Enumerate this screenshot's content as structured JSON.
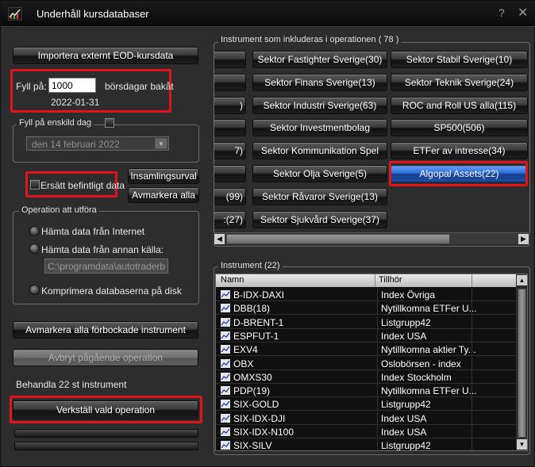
{
  "window": {
    "title": "Underhåll kursdatabaser",
    "help_glyph": "?",
    "close_glyph": "✕"
  },
  "left": {
    "import_button": "Importera externt EOD-kursdata",
    "fill_label": "Fyll på:",
    "fill_value": "1000",
    "fill_suffix": "börsdagar bakåt",
    "fill_date": "2022-01-31",
    "single_day_group": "Fyll på enskild dag",
    "single_day_value": "den 14   februari   2022",
    "replace_label": "Ersätt befintligt data",
    "collection_button": "Insamlingsurval",
    "unmark_all_button": "Avmarkera alla",
    "operation_group": "Operation att utföra",
    "op_internet": "Hämta data från Internet",
    "op_other_source": "Hämta data från annan källa:",
    "other_source_path": "C:\\programdata\\autotraderbas\\",
    "op_compress": "Komprimera databaserna på disk",
    "unmark_prechecked_button": "Avmarkera alla förbockade instrument",
    "cancel_operation_button": "Avbryt pågående operation",
    "status_text": "Behandla 22 st instrument",
    "execute_button": "Verkställ vald operation"
  },
  "instrument_selection": {
    "group_title": "Instrument som inkluderas i operationen  ( 78 )",
    "partial_col": [
      "",
      "",
      ")",
      "",
      "7)",
      "",
      "(99)",
      ":(27)"
    ],
    "col2": [
      "Sektor Fastighter Sverige(30)",
      "Sektor Finans Sverige(13)",
      "Sektor Industri Sverige(63)",
      "Sektor Investmentbolag",
      "Sektor Kommunikation Spel",
      "Sektor Olja Sverige(5)",
      "Sektor Råvaror Sverige(13)",
      "Sektor Sjukvård Sverige(37)"
    ],
    "col3": [
      "Sektor Stabil Sverige(10)",
      "Sektor Teknik Sverige(24)",
      "ROC and Roll US alla(115)",
      "SP500(506)",
      "ETFer av intresse(34)",
      "Algopal Assets(22)"
    ],
    "selected": "Algopal Assets(22)"
  },
  "instrument_list": {
    "group_title": "Instrument (22)",
    "columns": [
      "Namn",
      "Tillhör"
    ],
    "rows": [
      {
        "name": "B-IDX-DAXI",
        "group": "Index Övriga"
      },
      {
        "name": "DBB(18)",
        "group": "Nytillkomna ETFer U..."
      },
      {
        "name": "D-BRENT-1",
        "group": "Listgrupp42"
      },
      {
        "name": "ESPFUT-1",
        "group": "Index USA"
      },
      {
        "name": "EXV4",
        "group": "Nytillkomna aktier Ty..."
      },
      {
        "name": "OBX",
        "group": "Oslobörsen - index"
      },
      {
        "name": "OMXS30",
        "group": "Index Stockholm"
      },
      {
        "name": "PDP(19)",
        "group": "Nytillkomna ETFer U..."
      },
      {
        "name": "SIX-GOLD",
        "group": "Listgrupp42"
      },
      {
        "name": "SIX-IDX-DJI",
        "group": "Index USA"
      },
      {
        "name": "SIX-IDX-N100",
        "group": "Index USA"
      },
      {
        "name": "SIX-SILV",
        "group": "Listgrupp42"
      }
    ]
  },
  "colors": {
    "highlight": "#e1141b",
    "selected_button": "#2f6fd6"
  }
}
